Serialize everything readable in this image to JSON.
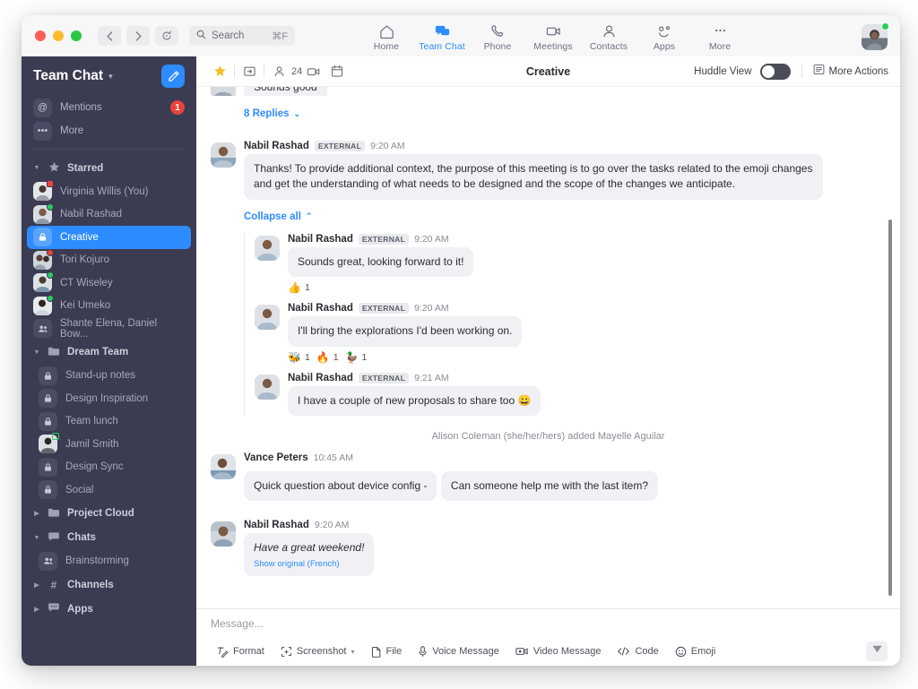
{
  "titlebar": {
    "nav_back": "‹",
    "nav_forward": "›",
    "history_icon": "history-icon",
    "search_placeholder": "Search",
    "search_shortcut": "⌘F",
    "nav_items": [
      {
        "label": "Home",
        "icon": "home-icon",
        "active": false
      },
      {
        "label": "Team Chat",
        "icon": "chat-bubbles-icon",
        "active": true
      },
      {
        "label": "Phone",
        "icon": "phone-icon",
        "active": false
      },
      {
        "label": "Meetings",
        "icon": "video-camera-icon",
        "active": false
      },
      {
        "label": "Contacts",
        "icon": "person-icon",
        "active": false
      },
      {
        "label": "Apps",
        "icon": "apps-icon",
        "active": false
      },
      {
        "label": "More",
        "icon": "ellipsis-icon",
        "active": false
      }
    ]
  },
  "sidebar": {
    "title": "Team Chat",
    "compose_icon": "compose-icon",
    "quick": [
      {
        "label": "Mentions",
        "icon": "at-icon",
        "badge": "1"
      },
      {
        "label": "More",
        "icon": "ellipsis-icon",
        "badge": ""
      }
    ],
    "sections": [
      {
        "label": "Starred",
        "icon": "star-icon",
        "expanded": true,
        "items": [
          {
            "label": "Virginia Willis (You)",
            "kind": "avatar",
            "presence": "rec",
            "selected": false
          },
          {
            "label": "Nabil Rashad",
            "kind": "avatar",
            "presence": "on",
            "selected": false
          },
          {
            "label": "Creative",
            "kind": "lock",
            "presence": "",
            "selected": true
          },
          {
            "label": "Tori Kojuro",
            "kind": "avatar",
            "presence": "busy",
            "selected": false
          },
          {
            "label": "CT Wiseley",
            "kind": "avatar",
            "presence": "on",
            "selected": false
          },
          {
            "label": "Kei Umeko",
            "kind": "avatar",
            "presence": "on",
            "selected": false
          },
          {
            "label": "Shante Elena, Daniel Bow...",
            "kind": "group",
            "presence": "",
            "selected": false
          }
        ]
      },
      {
        "label": "Dream Team",
        "icon": "folder-icon",
        "expanded": true,
        "items": [
          {
            "label": "Stand-up notes",
            "kind": "lock",
            "presence": "",
            "selected": false
          },
          {
            "label": "Design Inspiration",
            "kind": "lock",
            "presence": "",
            "selected": false
          },
          {
            "label": "Team lunch",
            "kind": "lock",
            "presence": "",
            "selected": false
          },
          {
            "label": "Jamil Smith",
            "kind": "avatar",
            "presence": "hollow",
            "selected": false
          },
          {
            "label": "Design Sync",
            "kind": "lock",
            "presence": "",
            "selected": false
          },
          {
            "label": "Social",
            "kind": "lock",
            "presence": "",
            "selected": false
          }
        ]
      },
      {
        "label": "Project Cloud",
        "icon": "folder-icon",
        "expanded": false,
        "items": []
      },
      {
        "label": "Chats",
        "icon": "chat-icon",
        "expanded": true,
        "items": [
          {
            "label": "Brainstorming",
            "kind": "group",
            "presence": "",
            "selected": false
          }
        ]
      },
      {
        "label": "Channels",
        "icon": "hash-icon",
        "expanded": false,
        "items": []
      },
      {
        "label": "Apps",
        "icon": "chat-dots-icon",
        "expanded": false,
        "items": []
      }
    ]
  },
  "channel_header": {
    "star_icon": "star-filled-icon",
    "share_icon": "share-folder-icon",
    "member_icon": "person-icon",
    "member_count": "24",
    "video_icon": "video-camera-icon",
    "calendar_icon": "calendar-icon",
    "name": "Creative",
    "huddle_label": "Huddle View",
    "huddle_on": false,
    "more_actions_icon": "list-panel-icon",
    "more_actions_label": "More Actions"
  },
  "messages": {
    "clipped_bubble_text": "Sounds good",
    "replies_link": "8 Replies",
    "replies_caret": "⌄",
    "parent": {
      "author": "Nabil Rashad",
      "badge": "EXTERNAL",
      "time": "9:20 AM",
      "text": "Thanks! To provide additional context, the purpose of this meeting is to go over the tasks related to the emoji changes and get the understanding of what needs to be designed and the scope of the changes we anticipate."
    },
    "collapse_link": "Collapse all",
    "collapse_caret": "⌃",
    "thread": [
      {
        "author": "Nabil Rashad",
        "badge": "EXTERNAL",
        "time": "9:20 AM",
        "text": "Sounds great, looking forward to it!",
        "reactions": [
          {
            "emoji": "👍",
            "count": "1"
          }
        ]
      },
      {
        "author": "Nabil Rashad",
        "badge": "EXTERNAL",
        "time": "9:20 AM",
        "text": "I'll bring the explorations I'd been working on.",
        "reactions": [
          {
            "emoji": "🐝",
            "count": "1"
          },
          {
            "emoji": "🔥",
            "count": "1"
          },
          {
            "emoji": "🦆",
            "count": "1"
          }
        ]
      },
      {
        "author": "Nabil Rashad",
        "badge": "EXTERNAL",
        "time": "9:21 AM",
        "text": "I have a couple of new proposals to share too 😀",
        "reactions": []
      }
    ],
    "system_event": "Alison Coleman (she/her/hers) added Mayelle Aguilar",
    "vance": {
      "author": "Vance Peters",
      "time": "10:45 AM",
      "line1": "Quick question about device config -",
      "line2": "Can someone help me with the last item?"
    },
    "translated": {
      "author": "Nabil Rashad",
      "time": "9:20 AM",
      "text": "Have a great weekend!",
      "show_original": "Show original (French)"
    }
  },
  "composer": {
    "placeholder": "Message...",
    "tools": [
      {
        "label": "Format",
        "icon": "format-icon",
        "caret": false
      },
      {
        "label": "Screenshot",
        "icon": "screenshot-icon",
        "caret": true
      },
      {
        "label": "File",
        "icon": "file-icon",
        "caret": false
      },
      {
        "label": "Voice Message",
        "icon": "microphone-icon",
        "caret": false
      },
      {
        "label": "Video Message",
        "icon": "video-message-icon",
        "caret": false
      },
      {
        "label": "Code",
        "icon": "code-icon",
        "caret": false
      },
      {
        "label": "Emoji",
        "icon": "emoji-icon",
        "caret": false
      }
    ],
    "send_icon": "send-icon"
  },
  "colors": {
    "accent": "#2d8cff",
    "sidebar_bg": "#3b3b52",
    "badge_red": "#e8443a",
    "presence_green": "#29cc5f",
    "bubble_bg": "#f0f1f4"
  }
}
